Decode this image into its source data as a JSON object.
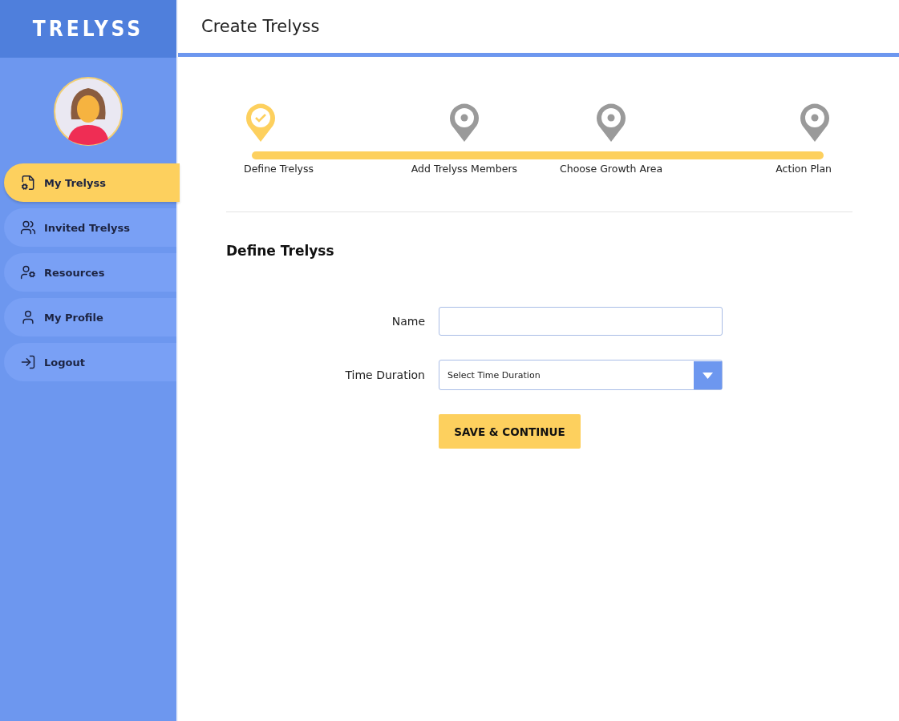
{
  "brand": "TRELYSS",
  "sidebar": {
    "items": [
      {
        "label": "My Trelyss",
        "kind": "file-gear",
        "selected": true
      },
      {
        "label": "Invited Trelyss",
        "kind": "group",
        "selected": false
      },
      {
        "label": "Resources",
        "kind": "user-gear",
        "selected": false
      },
      {
        "label": "My Profile",
        "kind": "user",
        "selected": false
      },
      {
        "label": "Logout",
        "kind": "logout",
        "selected": false
      }
    ]
  },
  "header": {
    "title": "Create Trelyss"
  },
  "steps": [
    {
      "label": "Define Trelyss",
      "completed": true
    },
    {
      "label": "Add Trelyss Members",
      "completed": false
    },
    {
      "label": "Choose Growth Area",
      "completed": false
    },
    {
      "label": "Action Plan",
      "completed": false
    }
  ],
  "section_title": "Define Trelyss",
  "form": {
    "name": {
      "label": "Name"
    },
    "time_duration": {
      "label": "Time Duration",
      "placeholder": "Select Time Duration"
    },
    "submit": "SAVE & CONTINUE"
  }
}
